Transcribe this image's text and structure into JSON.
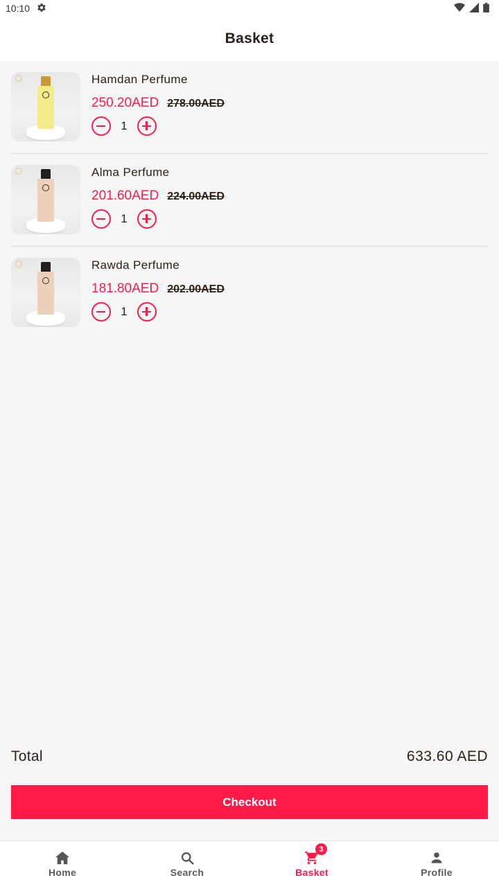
{
  "status_bar": {
    "time": "10:10",
    "icons": [
      "settings-icon",
      "wifi-icon",
      "cell-signal-icon",
      "battery-icon"
    ]
  },
  "header": {
    "title": "Basket"
  },
  "items": [
    {
      "name": "Hamdan Perfume",
      "price": "250.20AED",
      "old_price": "278.00AED",
      "quantity": "1",
      "bottle_color": "#f4ec8a",
      "cap_color": "#c89a3a"
    },
    {
      "name": "Alma Perfume",
      "price": "201.60AED",
      "old_price": "224.00AED",
      "quantity": "1",
      "bottle_color": "#ecd2bb",
      "cap_color": "#1e1e1e"
    },
    {
      "name": "Rawda Perfume",
      "price": "181.80AED",
      "old_price": "202.00AED",
      "quantity": "1",
      "bottle_color": "#ecd2bb",
      "cap_color": "#1e1e1e"
    }
  ],
  "summary": {
    "total_label": "Total",
    "total_value": "633.60 AED"
  },
  "checkout": {
    "label": "Checkout"
  },
  "nav": {
    "items": [
      {
        "label": "Home",
        "icon": "home-icon"
      },
      {
        "label": "Search",
        "icon": "search-icon"
      },
      {
        "label": "Basket",
        "icon": "cart-icon",
        "badge": "3",
        "active": true
      },
      {
        "label": "Profile",
        "icon": "profile-icon"
      }
    ]
  },
  "colors": {
    "accent": "#ff1a48",
    "text": "#2b2118",
    "background": "#f6f6f6"
  }
}
